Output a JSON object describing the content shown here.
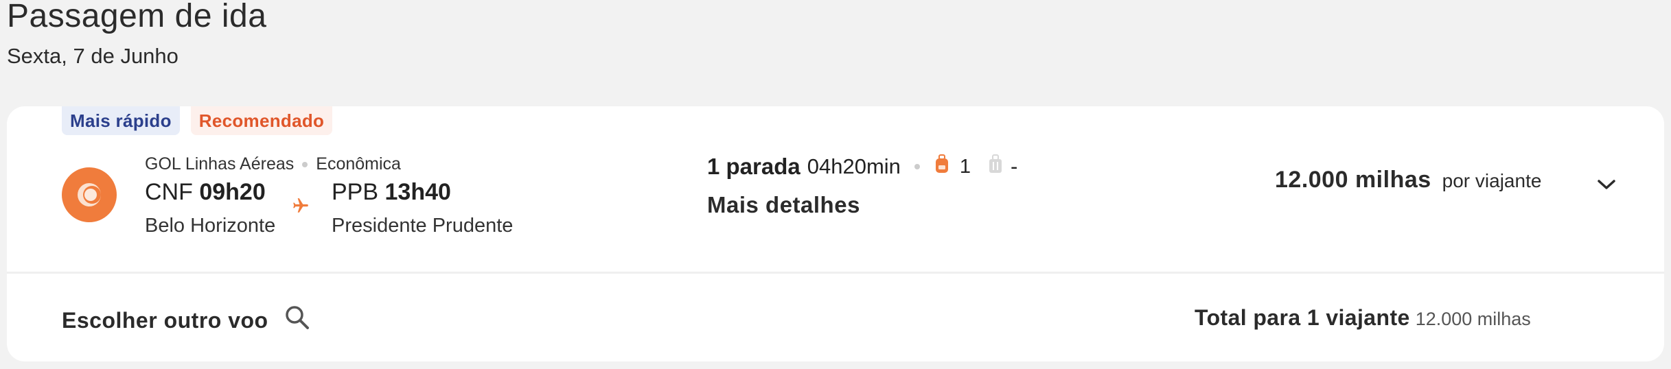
{
  "header": {
    "title": "Passagem de ida",
    "date": "Sexta, 7 de Junho"
  },
  "flight": {
    "badges": [
      "Mais rápido",
      "Recomendado"
    ],
    "airline": "GOL Linhas Aéreas",
    "cabin": "Econômica",
    "departure": {
      "code": "CNF",
      "time": "09h20",
      "city": "Belo Horizonte"
    },
    "arrival": {
      "code": "PPB",
      "time": "13h40",
      "city": "Presidente Prudente"
    },
    "stops": "1 parada",
    "duration": "04h20min",
    "carry_on_count": "1",
    "checked_bag": "-",
    "details_link": "Mais detalhes",
    "price": "12.000 milhas",
    "price_per": "por viajante",
    "icons": {
      "logo": "gol-logo-icon",
      "plane": "airplane-icon",
      "backpack": "backpack-icon",
      "suitcase": "suitcase-icon",
      "expand": "chevron-down-icon"
    }
  },
  "footer": {
    "choose_other": "Escolher outro voo",
    "total_label": "Total para 1 viajante",
    "total_amount": "12.000 milhas",
    "search_icon": "search-icon"
  },
  "colors": {
    "accent": "#f07c3c",
    "badge_fast_text": "#2b3f8c",
    "badge_rec_text": "#e0562a"
  }
}
